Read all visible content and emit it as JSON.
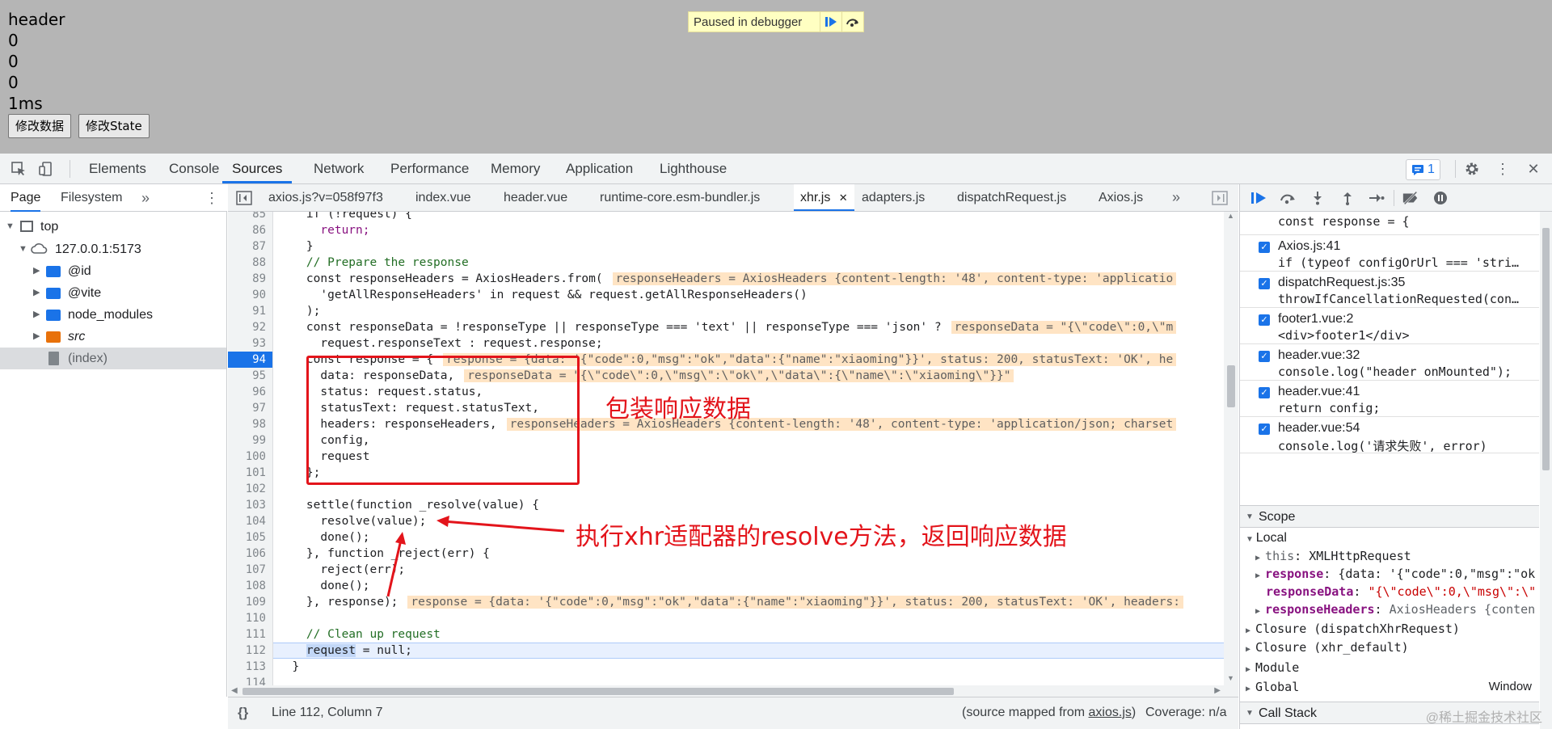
{
  "page": {
    "lines": [
      "header",
      "0",
      "0",
      "0",
      "1ms"
    ],
    "buttons": [
      "修改数据",
      "修改State"
    ],
    "paused_label": "Paused in debugger"
  },
  "devtools_tabs": [
    "Elements",
    "Console",
    "Sources",
    "Network",
    "Performance",
    "Memory",
    "Application",
    "Lighthouse"
  ],
  "active_devtools_tab": "Sources",
  "issues_count": "1",
  "navigator": {
    "tabs": [
      "Page",
      "Filesystem"
    ],
    "tree": [
      {
        "label": "top",
        "kind": "frame"
      },
      {
        "label": "127.0.0.1:5173",
        "kind": "cloud"
      },
      {
        "label": "@id",
        "kind": "folder"
      },
      {
        "label": "@vite",
        "kind": "folder"
      },
      {
        "label": "node_modules",
        "kind": "folder"
      },
      {
        "label": "src",
        "kind": "folder-src"
      },
      {
        "label": "(index)",
        "kind": "file"
      }
    ]
  },
  "editor_tabs": [
    "axios.js?v=058f97f3",
    "index.vue",
    "header.vue",
    "runtime-core.esm-bundler.js",
    "xhr.js",
    "adapters.js",
    "dispatchRequest.js",
    "Axios.js"
  ],
  "active_editor_tab": "xhr.js",
  "code": {
    "line_numbers": [
      "85",
      "86",
      "87",
      "88",
      "89",
      "90",
      "91",
      "92",
      "93",
      "94",
      "95",
      "96",
      "97",
      "98",
      "99",
      "100",
      "101",
      "102",
      "103",
      "104",
      "105",
      "106",
      "107",
      "108",
      "109",
      "110",
      "111",
      "112",
      "113",
      "114"
    ],
    "breakpoint_line": "94",
    "current_line": "112",
    "l85": "    if (!request) {",
    "l86": "      return;",
    "l87": "    }",
    "l88": "    // Prepare the response",
    "l89a": "    const responseHeaders = AxiosHeaders.from(",
    "l89b": "responseHeaders = AxiosHeaders {content-length: '48', content-type: 'applicatio",
    "l90": "      'getAllResponseHeaders' in request && request.getAllResponseHeaders()",
    "l91": "    );",
    "l92a": "    const responseData = !responseType || responseType === 'text' || responseType === 'json' ?",
    "l92b": "responseData = \"{\\\"code\\\":0,\\\"m",
    "l93": "      request.responseText : request.response;",
    "l94a": "    const response = {",
    "l94b": "response = {data: '{\"code\":0,\"msg\":\"ok\",\"data\":{\"name\":\"xiaoming\"}}', status: 200, statusText: 'OK', he",
    "l95a": "      data: responseData,",
    "l95b": "responseData = \"{\\\"code\\\":0,\\\"msg\\\":\\\"ok\\\",\\\"data\\\":{\\\"name\\\":\\\"xiaoming\\\"}}\"",
    "l96": "      status: request.status,",
    "l97": "      statusText: request.statusText,",
    "l98a": "      headers: responseHeaders,",
    "l98b": "responseHeaders = AxiosHeaders {content-length: '48', content-type: 'application/json; charset",
    "l99": "      config,",
    "l100": "      request",
    "l101": "    };",
    "l102": "",
    "l103": "    settle(function _resolve(value) {",
    "l104": "      resolve(value);",
    "l105": "      done();",
    "l106": "    }, function _reject(err) {",
    "l107": "      reject(err);",
    "l108": "      done();",
    "l109a": "    }, response);",
    "l109b": "response = {data: '{\"code\":0,\"msg\":\"ok\",\"data\":{\"name\":\"xiaoming\"}}', status: 200, statusText: 'OK', headers:",
    "l110": "",
    "l111": "    // Clean up request",
    "l112a": "request",
    "l112b": " = null;",
    "l113": "  }"
  },
  "annotations": {
    "box_label": "包装响应数据",
    "arrow_label": "执行xhr适配器的resolve方法，返回响应数据"
  },
  "status": {
    "position": "Line 112, Column 7",
    "source_prefix": "(source mapped from ",
    "source_link": "axios.js",
    "source_suffix": ")",
    "coverage": "Coverage: n/a"
  },
  "breakpoints": [
    {
      "file": "",
      "code": "const response = {"
    },
    {
      "file": "Axios.js:41",
      "code": "if (typeof configOrUrl === 'stri…"
    },
    {
      "file": "dispatchRequest.js:35",
      "code": "throwIfCancellationRequested(con…"
    },
    {
      "file": "footer1.vue:2",
      "code": "<div>footer1</div>"
    },
    {
      "file": "header.vue:32",
      "code": "console.log(\"header onMounted\");"
    },
    {
      "file": "header.vue:41",
      "code": "return config;"
    },
    {
      "file": "header.vue:54",
      "code": "console.log('请求失败', error)"
    }
  ],
  "scope": {
    "title": "Scope",
    "local_label": "Local",
    "this_key": "this",
    "this_val": "XMLHttpRequest",
    "response_key": "response",
    "response_val": "{data: '{\"code\":0,\"msg\":\"ok",
    "responseData_key": "responseData",
    "responseData_val": "\"{\\\"code\\\":0,\\\"msg\\\":\\\"",
    "responseHeaders_key": "responseHeaders",
    "responseHeaders_val": "AxiosHeaders {conten",
    "closure1": "Closure (dispatchXhrRequest)",
    "closure2": "Closure (xhr_default)",
    "module": "Module",
    "global": "Global",
    "global_val": "Window",
    "callstack": "Call Stack"
  },
  "watermark": "@稀土掘金技术社区",
  "colors": {
    "accent": "#1a73e8",
    "annotation": "#e3141b",
    "paused_bg": "#ffffc2"
  }
}
